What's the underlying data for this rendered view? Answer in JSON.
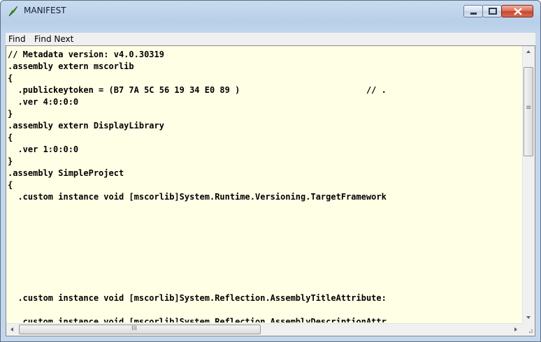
{
  "window": {
    "title": "MANIFEST"
  },
  "menu": {
    "find": "Find",
    "find_next": "Find Next"
  },
  "code_lines": [
    "// Metadata version: v4.0.30319",
    ".assembly extern mscorlib",
    "{",
    "  .publickeytoken = (B7 7A 5C 56 19 34 E0 89 )                         // .",
    "  .ver 4:0:0:0",
    "}",
    ".assembly extern DisplayLibrary",
    "{",
    "  .ver 1:0:0:0",
    "}",
    ".assembly SimpleProject",
    "{",
    "  .custom instance void [mscorlib]System.Runtime.Versioning.TargetFramework",
    "",
    "",
    "",
    "",
    "",
    "",
    "  .custom instance void [mscorlib]System.Reflection.AssemblyTitleAttribute:",
    "",
    "  .custom instance void [mscorlib]System.Reflection.AssemblyDescriptionAttr"
  ],
  "scrollbars": {
    "horizontal_grip": "III",
    "vertical_grip": "≡"
  },
  "colors": {
    "editor_background": "#ffffe6",
    "title_bar": "#b8cfe9",
    "close_button": "#c6452c"
  }
}
